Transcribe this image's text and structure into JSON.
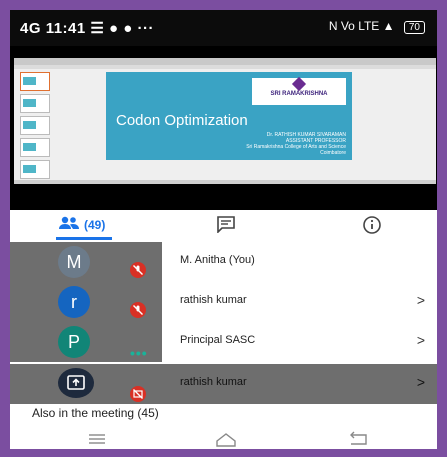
{
  "status_bar": {
    "signal": "4G",
    "time": "11:41",
    "right_icons": "N  Vo LTE  ▲",
    "battery": "70"
  },
  "slide": {
    "title": "Codon Optimization",
    "logo_text": "SRI RAMAKRISHNA",
    "subtitle_lines": [
      "Dr. RATHISH KUMAR SIVARAMAN",
      "ASSISTANT PROFESSOR",
      "Sri Ramakrishna College of Arts and Science",
      "Coimbatore"
    ]
  },
  "tabs": {
    "people_count": "(49)"
  },
  "participants": [
    {
      "initial": "M",
      "name": "M. Anitha (You)",
      "avatar_color": "#6c7b8a",
      "status": "muted",
      "chevron": ""
    },
    {
      "initial": "r",
      "name": "rathish kumar",
      "avatar_color": "#1565c0",
      "status": "muted",
      "chevron": ">"
    },
    {
      "initial": "P",
      "name": "Principal SASC",
      "avatar_color": "#118577",
      "status": "dots",
      "chevron": ">"
    },
    {
      "initial": "",
      "name": "rathish kumar",
      "avatar_color": "#1e2a3d",
      "status": "presenting",
      "chevron": ">"
    }
  ],
  "also_in_meeting": "Also in the meeting (45)",
  "colors": {
    "accent": "#1a73e8",
    "mute": "#d93025",
    "frame": "#7b4ea0"
  }
}
